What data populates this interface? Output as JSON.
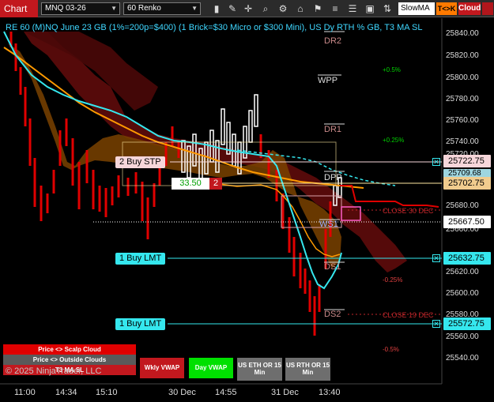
{
  "toolbar": {
    "app_title": "Chart",
    "instrument": "MNQ 03-26",
    "bar_type": "60 Renko",
    "slowma_label": "SlowMA",
    "tck_label": "T<>K",
    "cloud_label": "Cloud"
  },
  "chart": {
    "title": "RE 60 (M)NQ June 23 GB (1%=200p=$400) (1 Brick=$30 Micro or $300 Mini), US Dy RTH % GB, T3 MA SL",
    "pivots": {
      "dr2": "DR2",
      "wpp": "WPP",
      "dr1": "DR1",
      "dpp": "DPP",
      "ws1": "WS1",
      "ds1": "DS1",
      "ds2": "DS2"
    },
    "percent_levels": {
      "p05": "+0.5%",
      "p025": "+0.25%",
      "m025": "-0.25%",
      "m05": "-0.5%"
    },
    "close_levels": {
      "close_30dec": "CLOSE 30 DEC",
      "close_19dec": "CLOSE 19 DEC"
    },
    "orders": {
      "buy_stp": "2 Buy STP",
      "buy_lmt_1": "1 Buy LMT",
      "buy_lmt_2": "1 Buy LMT"
    },
    "position": {
      "pnl": "33.50",
      "qty": "2"
    },
    "price_axis": [
      "25840.00",
      "25820.00",
      "25800.00",
      "25780.00",
      "25760.00",
      "25740.00",
      "25720.00",
      "25680.00",
      "25660.00",
      "25620.00",
      "25600.00",
      "25580.00",
      "25560.00",
      "25540.00"
    ],
    "price_flags": {
      "stp": "25722.75",
      "last_hidden": "25709.68",
      "position": "25702.75",
      "current": "25667.50",
      "lmt_1": "25632.75",
      "lmt_2": "25572.75"
    },
    "time_axis": [
      "11:00",
      "14:34",
      "15:10",
      "30 Dec",
      "14:55",
      "31 Dec",
      "13:40"
    ],
    "colors": {
      "bull_brick": "#ffffff",
      "bear_brick": "#e00000",
      "cloud_bear": "#6a0d0d",
      "cloud_bull": "#8a4a00",
      "fast_ma": "#35e7ee",
      "slow_ma": "#ff9a00",
      "pnl_green": "#00d000"
    }
  },
  "bottom_panel": {
    "scalp_cloud": "Price <> Scalp Cloud",
    "outside_clouds": "Price <> Outside Clouds",
    "t3_ma_sl": "T3 MA SL",
    "wkly_vwap": "Wkly VWAP",
    "day_vwap": "Day VWAP",
    "us_eth_or": "US ETH OR 15 Min",
    "us_rth_or": "US RTH OR 15 Min",
    "copyright": "© 2025 NinjaTrader, LLC"
  }
}
